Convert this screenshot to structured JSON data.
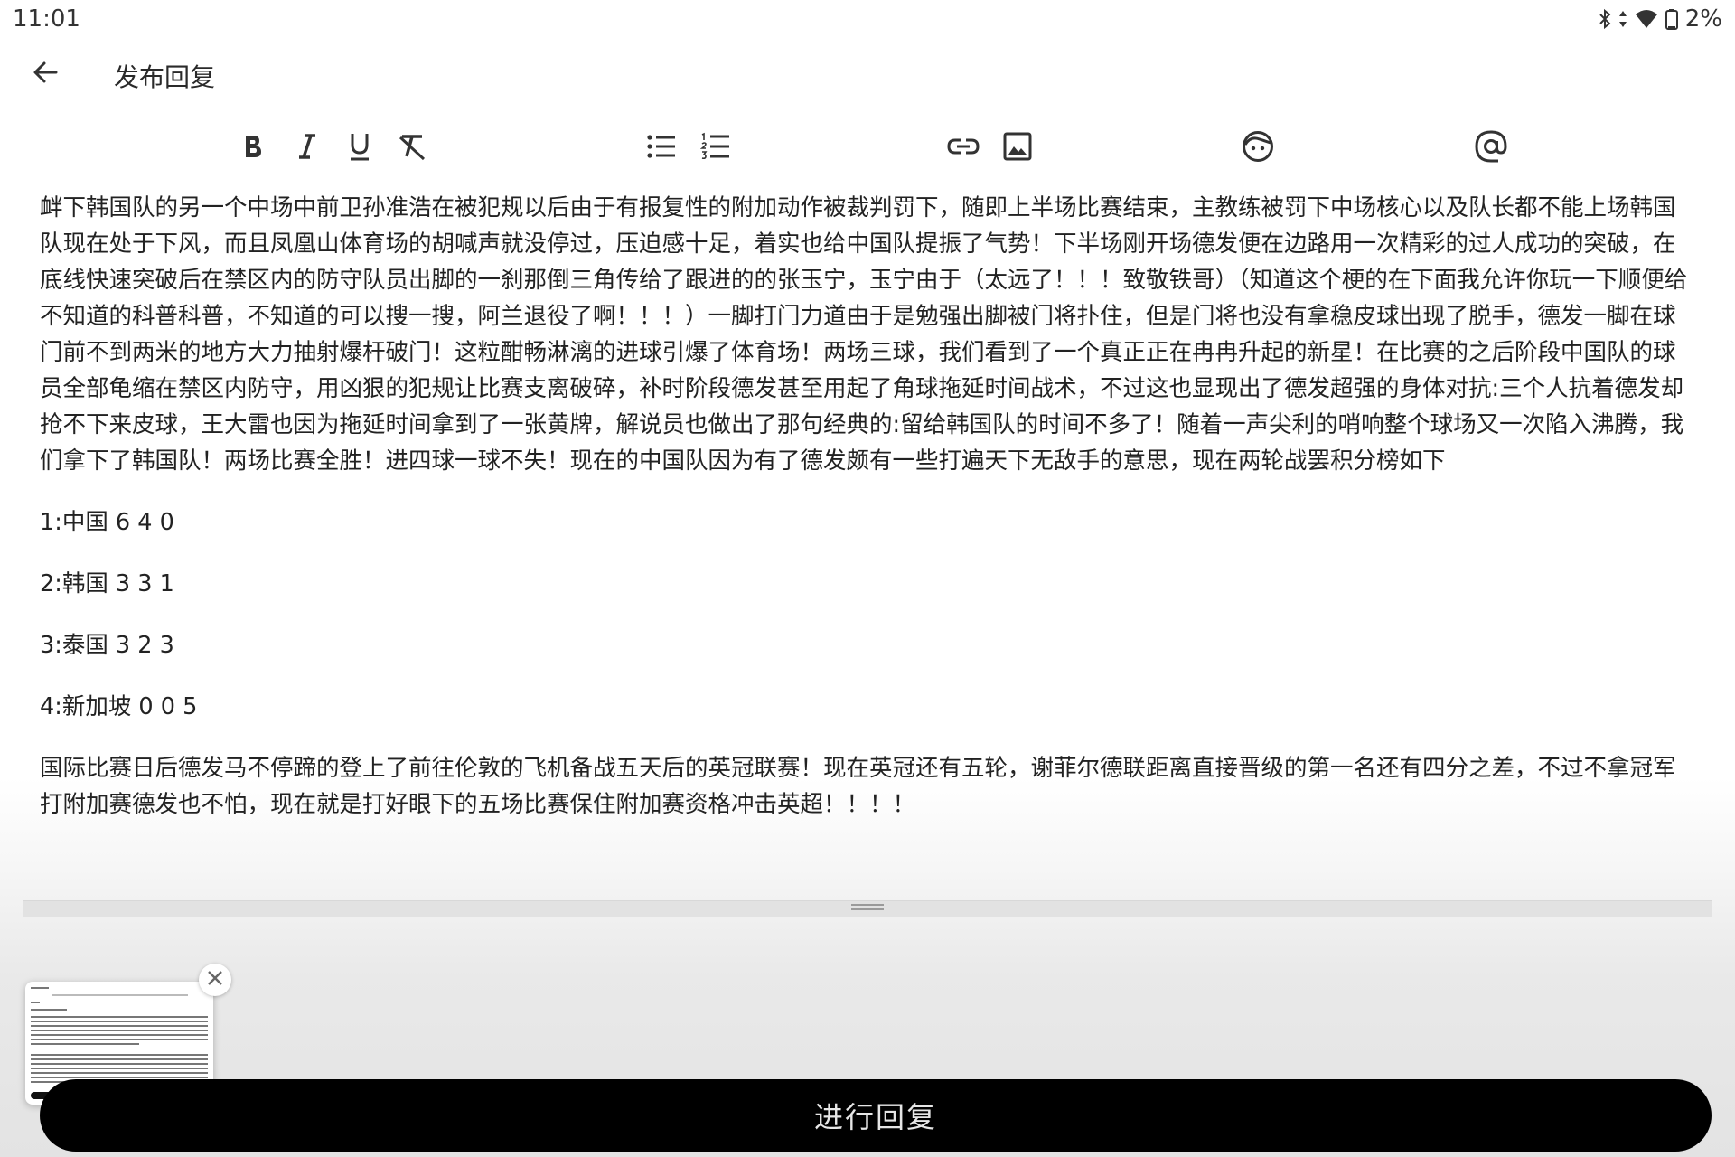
{
  "status_bar": {
    "time": "11:01",
    "battery_percent": "2%",
    "icons": [
      "bluetooth-icon",
      "data-arrows-icon",
      "wifi-icon",
      "battery-icon"
    ]
  },
  "app_bar": {
    "back_icon": "arrow-back-icon",
    "title": "发布回复"
  },
  "toolbar": {
    "items": [
      {
        "name": "bold",
        "icon": "bold-icon"
      },
      {
        "name": "italic",
        "icon": "italic-icon"
      },
      {
        "name": "underline",
        "icon": "underline-icon"
      },
      {
        "name": "clear-format",
        "icon": "clear-format-icon"
      },
      {
        "name": "bullet-list",
        "icon": "bullet-list-icon"
      },
      {
        "name": "numbered-list",
        "icon": "numbered-list-icon"
      },
      {
        "name": "link",
        "icon": "link-icon"
      },
      {
        "name": "image",
        "icon": "image-icon"
      },
      {
        "name": "emoji",
        "icon": "emoji-icon"
      },
      {
        "name": "mention",
        "icon": "at-icon"
      }
    ]
  },
  "editor": {
    "paragraph_1": "衅下韩国队的另一个中场中前卫孙准浩在被犯规以后由于有报复性的附加动作被裁判罚下，随即上半场比赛结束，主教练被罚下中场核心以及队长都不能上场韩国队现在处于下风，而且凤凰山体育场的胡喊声就没停过，压迫感十足，着实也给中国队提振了气势！下半场刚开场德发便在边路用一次精彩的过人成功的突破，在底线快速突破后在禁区内的防守队员出脚的一刹那倒三角传给了跟进的的张玉宁，玉宁由于（太远了！！！致敬铁哥）（知道这个梗的在下面我允许你玩一下顺便给不知道的科普科普，不知道的可以搜一搜，阿兰退役了啊！！！）一脚打门力道由于是勉强出脚被门将扑住，但是门将也没有拿稳皮球出现了脱手，德发一脚在球门前不到两米的地方大力抽射爆杆破门！这粒酣畅淋漓的进球引爆了体育场！两场三球，我们看到了一个真正正在冉冉升起的新星！在比赛的之后阶段中国队的球员全部龟缩在禁区内防守，用凶狠的犯规让比赛支离破碎，补时阶段德发甚至用起了角球拖延时间战术，不过这也显现出了德发超强的身体对抗:三个人抗着德发却抢不下来皮球，王大雷也因为拖延时间拿到了一张黄牌，解说员也做出了那句经典的:留给韩国队的时间不多了！随着一声尖利的哨响整个球场又一次陷入沸腾，我们拿下了韩国队！两场比赛全胜！进四球一球不失！现在的中国队因为有了德发颇有一些打遍天下无敌手的意思，现在两轮战罢积分榜如下",
    "standings": [
      "1:中国 6 4 0",
      "2:韩国 3 3 1",
      "3:泰国 3 2 3",
      "4:新加坡 0 0 5"
    ],
    "paragraph_2": "国际比赛日后德发马不停蹄的登上了前往伦敦的飞机备战五天后的英冠联赛！现在英冠还有五轮，谢菲尔德联距离直接晋级的第一名还有四分之差，不过不拿冠军打附加赛德发也不怕，现在就是打好眼下的五场比赛保住附加赛资格冲击英超！！！！"
  },
  "thumbnail": {
    "close_icon": "close-icon"
  },
  "reply_button": {
    "label": "进行回复"
  }
}
